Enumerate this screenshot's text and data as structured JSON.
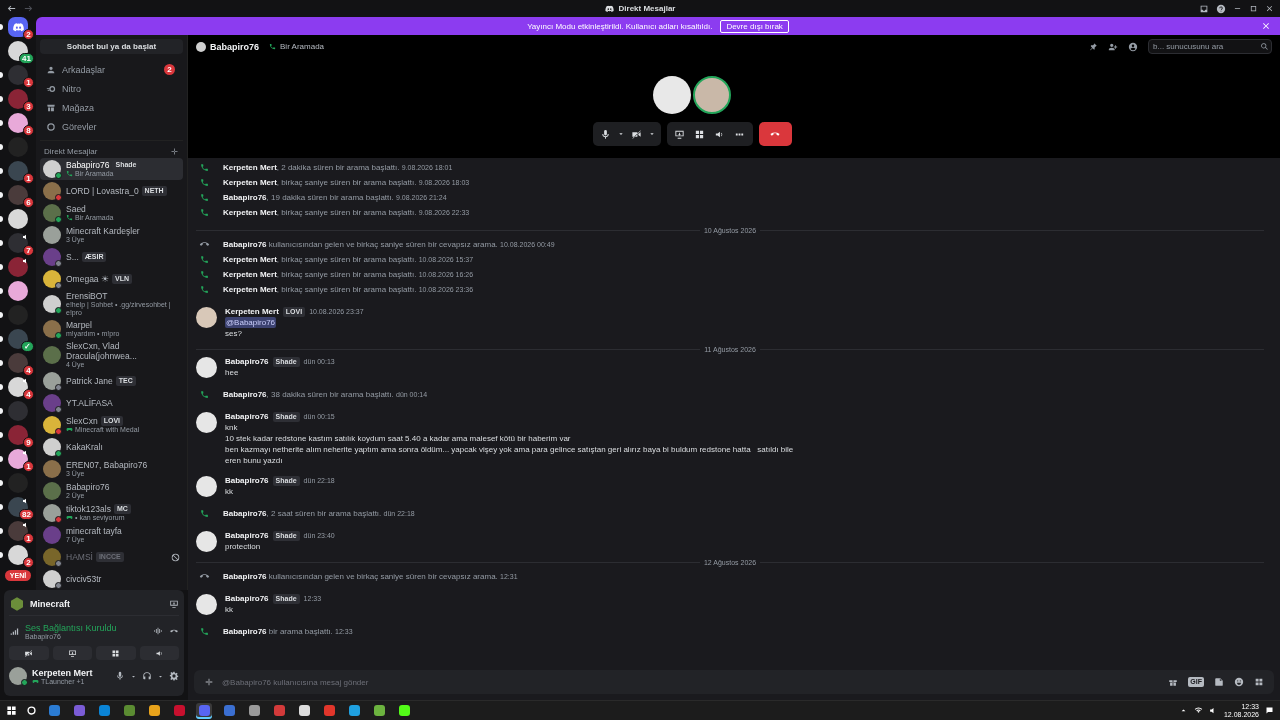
{
  "window": {
    "title": "Direkt Mesajlar"
  },
  "banner": {
    "text": "Yayıncı Modu etkinleştirildi. Kullanıcı adları kısaltıldı.",
    "button": "Devre dışı bırak"
  },
  "servers": [
    {
      "kind": "home",
      "badge": {
        "text": "2",
        "color": "#da373c"
      },
      "unread": true,
      "voice": false
    },
    {
      "kind": "server",
      "badge": {
        "text": "41",
        "color": "#23a55a"
      },
      "unread": false,
      "voice": false
    },
    {
      "kind": "server",
      "badge": {
        "text": "1",
        "color": "#da373c"
      },
      "unread": true,
      "voice": false
    },
    {
      "kind": "server",
      "badge": {
        "text": "3",
        "color": "#da373c"
      },
      "unread": true,
      "voice": false
    },
    {
      "kind": "server",
      "badge": {
        "text": "8",
        "color": "#da373c"
      },
      "unread": true,
      "voice": false
    },
    {
      "kind": "server",
      "unread": true,
      "voice": false
    },
    {
      "kind": "server",
      "badge": {
        "text": "1",
        "color": "#da373c"
      },
      "unread": true,
      "voice": false
    },
    {
      "kind": "server",
      "badge": {
        "text": "6",
        "color": "#da373c"
      },
      "unread": true,
      "voice": false
    },
    {
      "kind": "server",
      "unread": true,
      "voice": false
    },
    {
      "kind": "server",
      "badge": {
        "text": "7",
        "color": "#da373c"
      },
      "unread": true,
      "voice": true
    },
    {
      "kind": "server",
      "unread": true,
      "voice": true
    },
    {
      "kind": "server",
      "unread": true,
      "voice": false
    },
    {
      "kind": "server",
      "unread": true,
      "voice": false
    },
    {
      "kind": "server",
      "badge": {
        "text": "✓",
        "color": "#23a55a"
      },
      "unread": true,
      "voice": false
    },
    {
      "kind": "server",
      "badge": {
        "text": "4",
        "color": "#da373c"
      },
      "unread": true,
      "voice": false
    },
    {
      "kind": "server",
      "badge": {
        "text": "4",
        "color": "#da373c"
      },
      "unread": true,
      "voice": true
    },
    {
      "kind": "server",
      "unread": true,
      "voice": false
    },
    {
      "kind": "server",
      "badge": {
        "text": "9",
        "color": "#da373c"
      },
      "unread": true,
      "voice": false
    },
    {
      "kind": "server",
      "badge": {
        "text": "1",
        "color": "#da373c"
      },
      "unread": true,
      "voice": true
    },
    {
      "kind": "server",
      "unread": true,
      "voice": false
    },
    {
      "kind": "server",
      "badge": {
        "text": "82",
        "color": "#da373c"
      },
      "unread": true,
      "voice": true
    },
    {
      "kind": "server",
      "badge": {
        "text": "1",
        "color": "#da373c"
      },
      "unread": true,
      "voice": true
    },
    {
      "kind": "server",
      "badge": {
        "text": "2",
        "color": "#da373c"
      },
      "unread": true,
      "voice": false
    }
  ],
  "new_pill": "YENİ",
  "sidebar": {
    "search": "Sohbet bul ya da başlat",
    "nav": [
      {
        "kind": "friends",
        "label": "Arkadaşlar",
        "badge": "2"
      },
      {
        "kind": "nitro",
        "label": "Nitro"
      },
      {
        "kind": "shop",
        "label": "Mağaza"
      },
      {
        "kind": "quests",
        "label": "Görevler"
      }
    ],
    "dm_header": "Direkt Mesajlar",
    "dms": [
      {
        "name": "Babapiro76",
        "tag": "Shade",
        "sub": "Bir Aramada",
        "in_call": true,
        "color": "#23a55a",
        "selected": true
      },
      {
        "name": "LORD | Lovastra_0",
        "tag": "NETH",
        "color": "#da373c",
        "selected": false
      },
      {
        "name": "Saed",
        "sub": "Bir Aramada",
        "in_call": true,
        "color": "#23a55a",
        "selected": false
      },
      {
        "name": "Minecraft Kardeşler",
        "sub": "3 Üye",
        "selected": false
      },
      {
        "name": "S...",
        "tag": "ÆSIR",
        "color": "#80848e",
        "selected": false
      },
      {
        "name": "Omegaa ☀",
        "tag": "VLN",
        "color": "#80848e",
        "selected": false
      },
      {
        "name": "ErensiBOT",
        "sub": "e!help | Sohbet • .gg/zirvesohbet | e!pro",
        "color": "#23a55a",
        "selected": false
      },
      {
        "name": "Marpel",
        "sub": "m!yardım • m!pro",
        "color": "#23a55a",
        "selected": false
      },
      {
        "name": "SlexCxn, Vlad Dracula(johnwea...",
        "sub": "4 Üye",
        "selected": false
      },
      {
        "name": "Patrick Jane",
        "tag": "TEC",
        "color": "#80848e",
        "selected": false
      },
      {
        "name": "YT.ALİFASA",
        "color": "#80848e",
        "selected": false
      },
      {
        "name": "SlexCxn",
        "tag": "LOVI",
        "sub": "Minecraft with Medal",
        "playing": true,
        "color": "#da373c",
        "selected": false
      },
      {
        "name": "KakaKralı",
        "color": "#23a55a",
        "selected": false
      },
      {
        "name": "EREN07, Babapiro76",
        "sub": "3 Üye",
        "selected": false
      },
      {
        "name": "Babapiro76",
        "sub": "2 Üye",
        "selected": false
      },
      {
        "name": "tiktok123als",
        "tag": "MC",
        "sub": "• kan seviyorum",
        "playing": true,
        "color": "#da373c",
        "selected": false
      },
      {
        "name": "minecraft tayfa",
        "sub": "7 Üye",
        "selected": false
      },
      {
        "name": "HAMSİ",
        "tag": "INCCE",
        "color": "#80848e",
        "selected": false,
        "blocked": true
      },
      {
        "name": "civciv53tr",
        "color": "#80848e",
        "selected": false
      }
    ]
  },
  "panel": {
    "game": "Minecraft",
    "voice_status": "Ses Bağlantısı Kuruldu",
    "voice_channel": "Babapiro76",
    "user": "Kerpeten Mert",
    "activity": "TLauncher +1"
  },
  "header": {
    "name": "Babapiro76",
    "status": "Bir Aramada",
    "search_placeholder": "b... sunucusunu ara"
  },
  "messages": [
    {
      "kind": "call",
      "name": "Kerpeten Mert",
      "text": ", 2 dakika süren bir arama başlattı.",
      "time": "9.08.2026 18:01"
    },
    {
      "kind": "call",
      "name": "Kerpeten Mert",
      "text": ", birkaç saniye süren bir arama başlattı.",
      "time": "9.08.2026 18:03"
    },
    {
      "kind": "call",
      "name": "Babapiro76",
      "text": ", 19 dakika süren bir arama başlattı.",
      "time": "9.08.2026 21:24"
    },
    {
      "kind": "call",
      "name": "Kerpeten Mert",
      "text": ", birkaç saniye süren bir arama başlattı.",
      "time": "9.08.2026 22:33"
    },
    {
      "kind": "divider",
      "text": "10 Ağustos 2026"
    },
    {
      "kind": "missed_call",
      "name": "Babapiro76",
      "text": " kullanıcısından gelen ve birkaç saniye süren bir cevapsız arama.",
      "time": "10.08.2026 00:49"
    },
    {
      "kind": "call",
      "name": "Kerpeten Mert",
      "text": ", birkaç saniye süren bir arama başlattı.",
      "time": "10.08.2026 15:37"
    },
    {
      "kind": "call",
      "name": "Kerpeten Mert",
      "text": ", birkaç saniye süren bir arama başlattı.",
      "time": "10.08.2026 16:26"
    },
    {
      "kind": "call",
      "name": "Kerpeten Mert",
      "text": ", birkaç saniye süren bir arama başlattı.",
      "time": "10.08.2026 23:36"
    },
    {
      "kind": "message",
      "name": "Kerpeten Mert",
      "tag": "LOVI",
      "time": "10.08.2026 23:37",
      "mention": "@Babapiro76",
      "lines": [
        "ses?"
      ]
    },
    {
      "kind": "divider",
      "text": "11 Ağustos 2026"
    },
    {
      "kind": "message",
      "name": "Babapiro76",
      "tag": "Shade",
      "time": "dün 00:13",
      "lines": [
        "hee"
      ]
    },
    {
      "kind": "call",
      "name": "Babapiro76",
      "text": ", 38 dakika süren bir arama başlattı.",
      "time": "dün 00:14"
    },
    {
      "kind": "message",
      "name": "Babapiro76",
      "tag": "Shade",
      "time": "dün 00:15",
      "lines": [
        "knk",
        "10 stek kadar redstone kastım satılık koydum saat 5.40 a kadar ama malesef kötü bir haberim var",
        "ben kazmayı netherite alım neherite yaptım ama sonra öldüm... yapcak vişey yok ama para gelince satıştan geri alırız baya bi buldum redstone hatta   satıldı bile",
        "eren bunu yazdı"
      ]
    },
    {
      "kind": "message",
      "name": "Babapiro76",
      "tag": "Shade",
      "time": "dün 22:18",
      "lines": [
        "kk"
      ]
    },
    {
      "kind": "call",
      "name": "Babapiro76",
      "text": ", 2 saat süren bir arama başlattı.",
      "time": "dün 22:18"
    },
    {
      "kind": "message",
      "name": "Babapiro76",
      "tag": "Shade",
      "time": "dün 23:40",
      "lines": [
        "protection"
      ]
    },
    {
      "kind": "divider",
      "text": "12 Ağustos 2026"
    },
    {
      "kind": "missed_call",
      "name": "Babapiro76",
      "text": " kullanıcısından gelen ve birkaç saniye süren bir cevapsız arama.",
      "time": "12:31"
    },
    {
      "kind": "message",
      "name": "Babapiro76",
      "tag": "Shade",
      "time": "12:33",
      "lines": [
        "kk"
      ]
    },
    {
      "kind": "call",
      "name": "Babapiro76",
      "text": " bir arama başlattı.",
      "time": "12:33"
    }
  ],
  "composer": {
    "placeholder": "@Babapiro76 kullanıcısına mesaj gönder",
    "gif": "GIF"
  },
  "taskbar": {
    "apps": [
      {
        "color": "#2b7cd3",
        "selected": false
      },
      {
        "color": "#7b5cd6",
        "selected": false
      },
      {
        "color": "#0a84d6",
        "selected": false
      },
      {
        "color": "#5b8c32",
        "selected": false
      },
      {
        "color": "#e8a31b",
        "selected": false
      },
      {
        "color": "#c8102e",
        "selected": false
      },
      {
        "color": "#5865f2",
        "selected": true
      },
      {
        "color": "#3b6fd1",
        "selected": false
      },
      {
        "color": "#9a9a9a",
        "selected": false
      },
      {
        "color": "#d33a3a",
        "selected": false
      },
      {
        "color": "#dddddd",
        "selected": false
      },
      {
        "color": "#e2362b",
        "selected": false
      },
      {
        "color": "#1fa0e0",
        "selected": false
      },
      {
        "color": "#6cb33f",
        "selected": false
      },
      {
        "color": "#53fc18",
        "selected": false
      }
    ],
    "time": "12:33",
    "date": "12.08.2026"
  }
}
